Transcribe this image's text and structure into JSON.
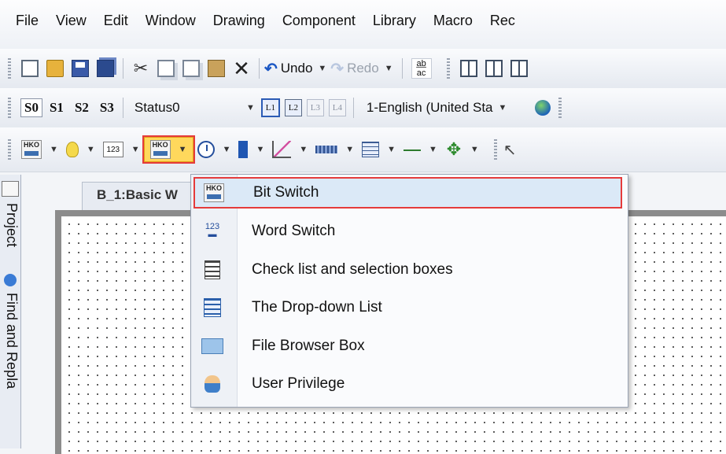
{
  "menubar": {
    "items": [
      "File",
      "View",
      "Edit",
      "Window",
      "Drawing",
      "Component",
      "Library",
      "Macro",
      "Rec"
    ]
  },
  "toolbar1": {
    "undo_label": "Undo",
    "redo_label": "Redo",
    "abc_label": "a̲b̲ ac"
  },
  "toolbar2": {
    "status_buttons": [
      "S0",
      "S1",
      "S2",
      "S3"
    ],
    "status_value": "Status0",
    "layer_buttons": [
      "L1",
      "L2",
      "L3",
      "L4"
    ],
    "language_value": "1-English (United Sta"
  },
  "toolbar3": {
    "bit_switch_icon_text": "HKO"
  },
  "side_panel": {
    "project_label": "Project",
    "find_label": "Find and Repla"
  },
  "editor": {
    "tab_label": "B_1:Basic W"
  },
  "dropdown": {
    "items": [
      {
        "label": "Bit Switch",
        "icon": "bit-switch-icon"
      },
      {
        "label": "Word Switch",
        "icon": "word-switch-icon"
      },
      {
        "label": "Check list and selection boxes",
        "icon": "check-list-icon"
      },
      {
        "label": "The Drop-down List",
        "icon": "dropdown-list-icon"
      },
      {
        "label": "File Browser Box",
        "icon": "file-browser-icon"
      },
      {
        "label": "User Privilege",
        "icon": "user-privilege-icon"
      }
    ]
  },
  "colors": {
    "highlight_border": "#e53b3b",
    "selected_item_bg": "#dbe9f7",
    "active_button_bg": "#ffd85c"
  }
}
